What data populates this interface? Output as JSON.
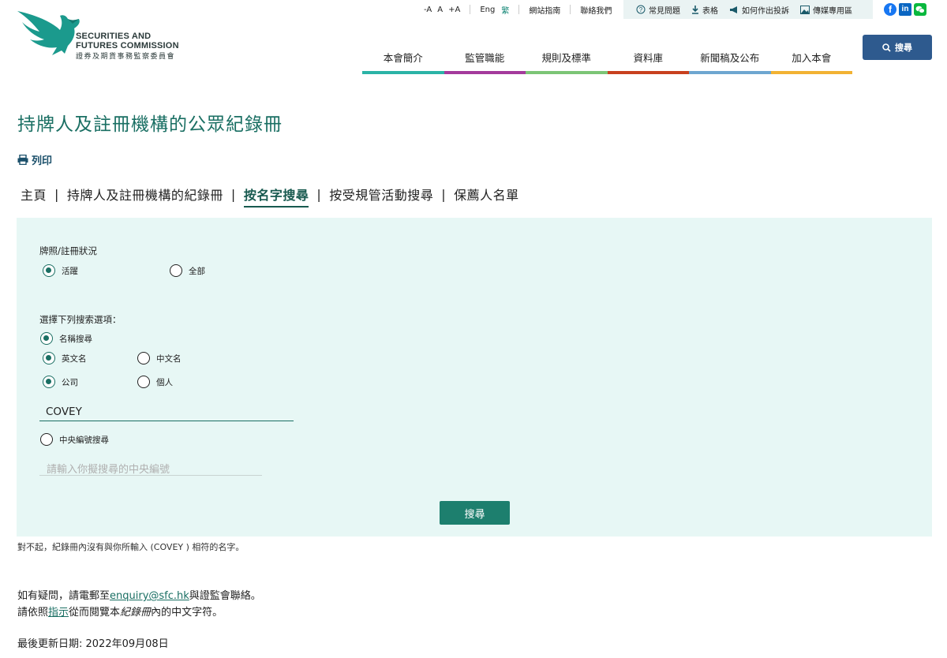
{
  "header": {
    "logo_en_line1": "SECURITIES AND",
    "logo_en_line2": "FUTURES COMMISSION",
    "logo_zh": "證券及期貨事務監察委員會",
    "font_sizes": [
      "-A",
      "A",
      "+A"
    ],
    "lang_en": "Eng",
    "lang_zh": "繁",
    "sitemap": "網站指南",
    "contact": "聯絡我們",
    "quick_links": [
      {
        "label": "常見問題",
        "icon": "question-icon"
      },
      {
        "label": "表格",
        "icon": "download-icon"
      },
      {
        "label": "如何作出投訴",
        "icon": "megaphone-icon"
      },
      {
        "label": "傳媒專用區",
        "icon": "image-icon"
      }
    ],
    "social": {
      "facebook": "f",
      "linkedin": "in"
    },
    "search_label": "搜尋",
    "nav": [
      {
        "label": "本會簡介",
        "color": "#2bb3a6"
      },
      {
        "label": "監管職能",
        "color": "#a43a9c"
      },
      {
        "label": "規則及標準",
        "color": "#7cc576"
      },
      {
        "label": "資料庫",
        "color": "#c8401e"
      },
      {
        "label": "新聞稿及公布",
        "color": "#6ea6d0"
      },
      {
        "label": "加入本會",
        "color": "#f2b233"
      }
    ]
  },
  "page": {
    "title": "持牌人及註冊機構的公眾紀錄冊",
    "print_label": "列印",
    "breadcrumbs": [
      "主頁",
      "持牌人及註冊機構的紀錄冊",
      "按名字搜尋",
      "按受規管活動搜尋",
      "保薦人名單"
    ],
    "active_crumb": "按名字搜尋"
  },
  "form": {
    "status_label": "牌照/註冊狀況",
    "status_active": "活躍",
    "status_all": "全部",
    "options_label": "選擇下列搜索選項：",
    "name_search": "名稱搜尋",
    "english_name": "英文名",
    "chinese_name": "中文名",
    "company": "公司",
    "individual": "個人",
    "name_value": "COVEY",
    "ce_search": "中央編號搜尋",
    "ce_placeholder": "請輸入你擬搜尋的中央編號",
    "submit_label": "搜尋"
  },
  "footer": {
    "no_result": "對不起，紀錄冊內沒有與你所輸入 (COVEY ) 相符的名字。",
    "enquiry_prefix": "如有疑問，請電郵至",
    "enquiry_email": "enquiry@sfc.hk",
    "enquiry_suffix": "與證監會聯絡。",
    "guide_prefix": "請依照",
    "guide_link": "指示",
    "guide_middle": "從而閱覽本",
    "guide_italic": "紀錄冊",
    "guide_suffix": "內的中文字符。",
    "updated": "最後更新日期: 2022年09月08日"
  }
}
